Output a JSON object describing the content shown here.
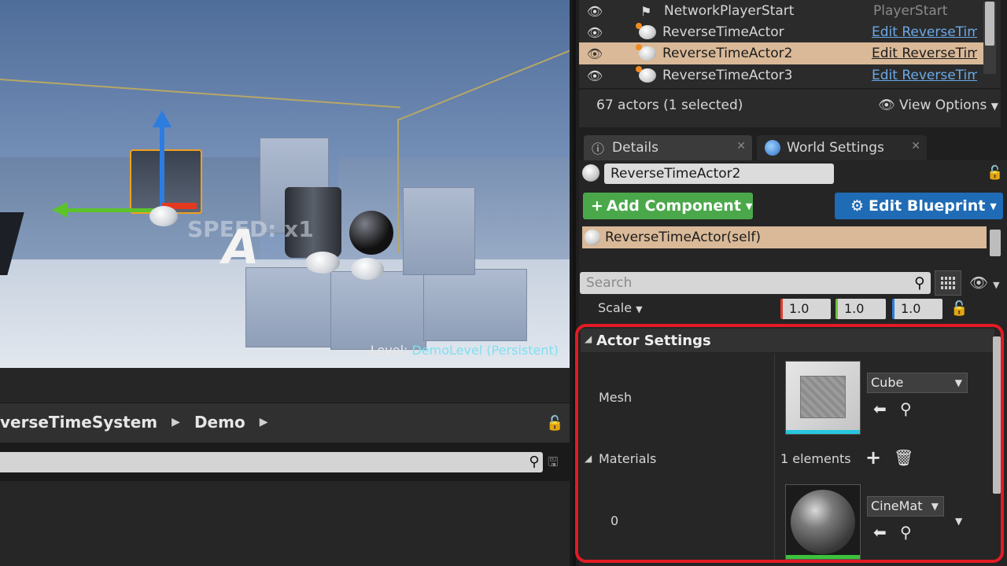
{
  "viewport": {
    "overlay_text": "SPEED: x1",
    "sign_letter": "A",
    "level_label": "Level:",
    "level_name": "DemoLevel (Persistent)"
  },
  "content_browser": {
    "breadcrumb": [
      "verseTimeSystem",
      "Demo"
    ]
  },
  "outliner": {
    "rows": [
      {
        "name": "NetworkPlayerStart",
        "type": "PlayerStart"
      },
      {
        "name": "ReverseTimeActor",
        "type": "Edit ReverseTim"
      },
      {
        "name": "ReverseTimeActor2",
        "type": "Edit ReverseTim"
      },
      {
        "name": "ReverseTimeActor3",
        "type": "Edit ReverseTim"
      }
    ],
    "actor_count": "67 actors (1 selected)",
    "view_options": "View Options"
  },
  "tabs": {
    "details": "Details",
    "world_settings": "World Settings"
  },
  "details": {
    "actor_name": "ReverseTimeActor2",
    "add_component": "Add Component",
    "edit_blueprint": "Edit Blueprint",
    "component_root": "ReverseTimeActor(self)",
    "search_placeholder": "Search",
    "scale_label": "Scale",
    "scale": {
      "x": "1.0",
      "y": "1.0",
      "z": "1.0"
    },
    "actor_settings": {
      "header": "Actor Settings",
      "mesh_label": "Mesh",
      "mesh_value": "Cube",
      "materials_label": "Materials",
      "materials_count": "1 elements",
      "element_index": "0",
      "material_value": "CineMat"
    }
  },
  "colors": {
    "selection": "#d9b998",
    "add_component": "#4aa84b",
    "edit_blueprint": "#1f6bb5",
    "highlight_border": "#e21b24"
  }
}
